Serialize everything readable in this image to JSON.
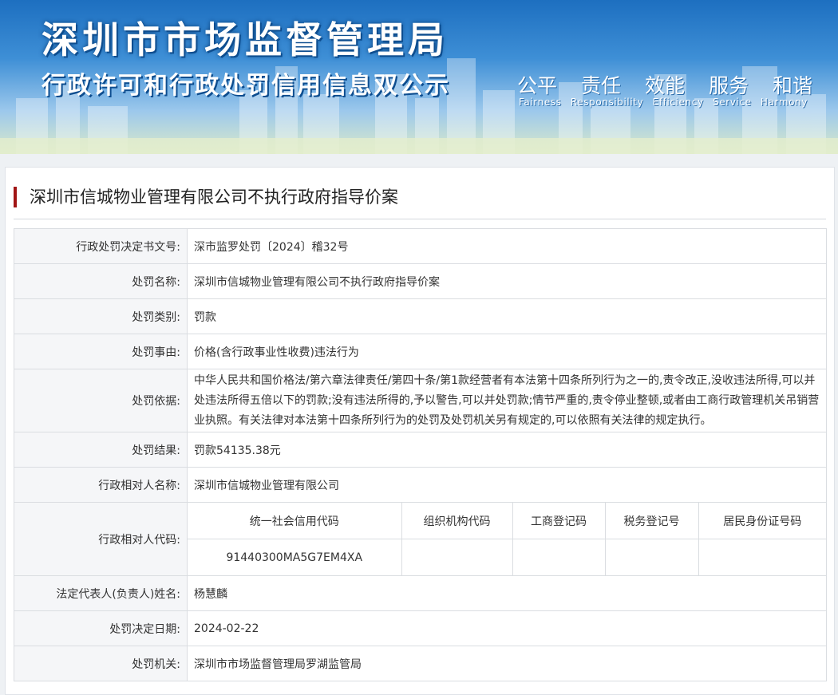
{
  "banner": {
    "title": "深圳市市场监督管理局",
    "subtitle": "行政许可和行政处罚信用信息双公示",
    "slogans": [
      {
        "cn": "公平",
        "en": "Fairness"
      },
      {
        "cn": "责任",
        "en": "Responsibility"
      },
      {
        "cn": "效能",
        "en": "Efficiency"
      },
      {
        "cn": "服务",
        "en": "Service"
      },
      {
        "cn": "和谐",
        "en": "Harmony"
      }
    ]
  },
  "case_title": "深圳市信城物业管理有限公司不执行政府指导价案",
  "rows": {
    "doc_no": {
      "label": "行政处罚决定书文号:",
      "value": "深市监罗处罚〔2024〕稽32号"
    },
    "name": {
      "label": "处罚名称:",
      "value": "深圳市信城物业管理有限公司不执行政府指导价案"
    },
    "category": {
      "label": "处罚类别:",
      "value": "罚款"
    },
    "reason": {
      "label": "处罚事由:",
      "value": "价格(含行政事业性收费)违法行为"
    },
    "basis": {
      "label": "处罚依据:",
      "value": "中华人民共和国价格法/第六章法律责任/第四十条/第1款经营者有本法第十四条所列行为之一的,责令改正,没收违法所得,可以并处违法所得五倍以下的罚款;没有违法所得的,予以警告,可以并处罚款;情节严重的,责令停业整顿,或者由工商行政管理机关吊销营业执照。有关法律对本法第十四条所列行为的处罚及处罚机关另有规定的,可以依照有关法律的规定执行。"
    },
    "result": {
      "label": "处罚结果:",
      "value": "罚款54135.38元"
    },
    "party_name": {
      "label": "行政相对人名称:",
      "value": "深圳市信城物业管理有限公司"
    },
    "party_code": {
      "label": "行政相对人代码:",
      "headers": [
        "统一社会信用代码",
        "组织机构代码",
        "工商登记码",
        "税务登记号",
        "居民身份证号码"
      ],
      "values": [
        "91440300MA5G7EM4XA",
        "",
        "",
        "",
        ""
      ]
    },
    "legal_rep": {
      "label": "法定代表人(负责人)姓名:",
      "value": "杨慧麟"
    },
    "date": {
      "label": "处罚决定日期:",
      "value": "2024-02-22"
    },
    "authority": {
      "label": "处罚机关:",
      "value": "深圳市市场监督管理局罗湖监管局"
    }
  },
  "colors": {
    "accent": "#a11515",
    "banner_blue": "#1d6fc0"
  }
}
